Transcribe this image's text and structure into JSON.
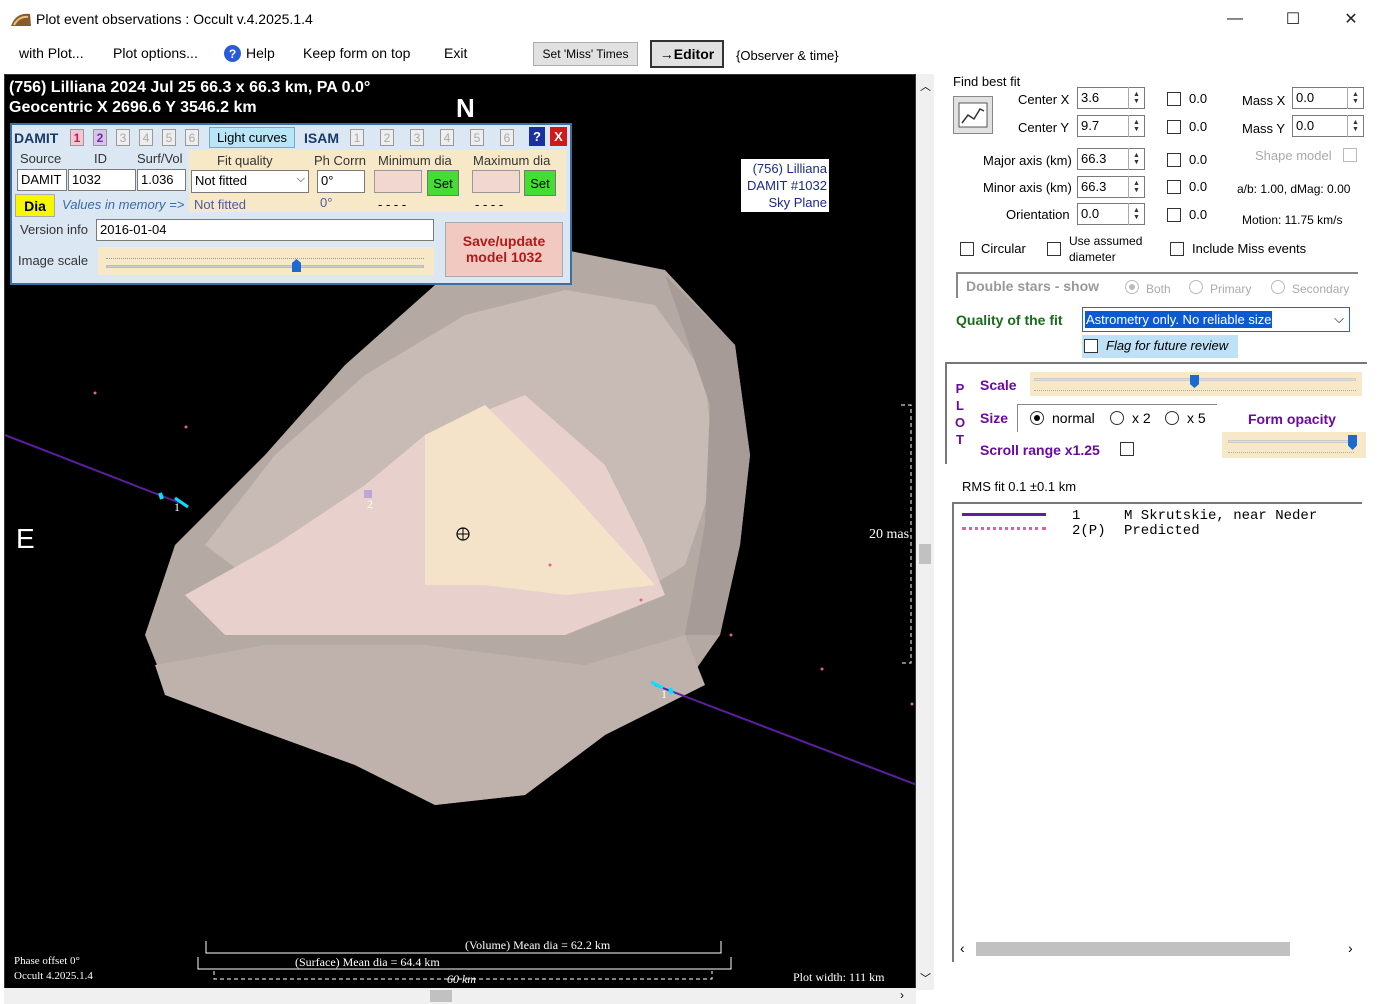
{
  "window": {
    "title": "Plot event observations : Occult v.4.2025.1.4",
    "minimize": "—",
    "maximize": "☐",
    "close": "✕"
  },
  "menu": {
    "with_plot": "with Plot...",
    "plot_options": "Plot options...",
    "help": "Help",
    "keep_on_top": "Keep form on top",
    "exit": "Exit",
    "set_miss_times": "Set 'Miss' Times",
    "editor": "→Editor",
    "observer_time": "{Observer & time}"
  },
  "plot": {
    "header_line1": "(756) Lilliana  2024 Jul 25   66.3 x 66.3 km, PA 0.0°",
    "header_line2": "Geocentric  X  2696.6  Y 3546.2 km",
    "north": "N",
    "east": "E",
    "model_label": [
      "(756) Lilliana",
      "DAMIT #1032",
      "Sky Plane"
    ],
    "scale_mas": "20 mas",
    "volume_dia": "(Volume) Mean dia = 62.2 km",
    "surface_dia": "(Surface) Mean dia = 64.4 km",
    "scale_km": "60 km",
    "phase_offset": "Phase offset 0°",
    "version": "Occult 4.2025.1.4",
    "plot_width": "Plot width: 111 km",
    "chord_labels": [
      "1",
      "2",
      "1"
    ]
  },
  "damit": {
    "damit_label": "DAMIT",
    "tabs": [
      "1",
      "2",
      "3",
      "4",
      "5",
      "6"
    ],
    "light_curves": "Light curves",
    "isam_label": "ISAM",
    "isam_tabs": [
      "1",
      "2",
      "3",
      "4",
      "5",
      "6"
    ],
    "help": "?",
    "close": "X",
    "source_label": "Source",
    "id_label": "ID",
    "surfvol_label": "Surf/Vol",
    "source": "DAMIT",
    "id": "1032",
    "surfvol": "1.036",
    "fit_quality_label": "Fit quality",
    "ph_corrn_label": "Ph Corrn",
    "min_dia_label": "Minimum dia",
    "max_dia_label": "Maximum dia",
    "fit_quality": "Not fitted",
    "ph_corrn": "0°",
    "set": "Set",
    "dia": "Dia",
    "values_in_memory": "Values in memory =>",
    "mem_fit": "Not fitted",
    "mem_ph": "0°",
    "mem_min": "- - - -",
    "mem_max": "- - - -",
    "version_label": "Version info",
    "version": "2016-01-04",
    "image_scale_label": "Image scale",
    "save_update": "Save/update",
    "model_num": "model 1032"
  },
  "fit": {
    "find_best_fit": "Find best fit",
    "center_x_label": "Center X",
    "center_x": "3.6",
    "center_y_label": "Center Y",
    "center_y": "9.7",
    "major_label": "Major axis (km)",
    "major": "66.3",
    "minor_label": "Minor axis (km)",
    "minor": "66.3",
    "orient_label": "Orientation",
    "orient": "0.0",
    "zero": "0.0",
    "mass_x_label": "Mass X",
    "mass_x": "0.0",
    "mass_y_label": "Mass Y",
    "mass_y": "0.0",
    "shape_model": "Shape model",
    "ab_dmag": "a/b: 1.00, dMag: 0.00",
    "motion": "Motion: 11.75 km/s",
    "circular": "Circular",
    "use_assumed": "Use assumed",
    "diameter": "diameter",
    "include_miss": "Include Miss events",
    "double_stars": "Double stars - show",
    "both": "Both",
    "primary": "Primary",
    "secondary": "Secondary",
    "quality_label": "Quality of the fit",
    "quality_value": "Astrometry only. No reliable size",
    "flag_review": "Flag for future review"
  },
  "plotbox": {
    "p": "P",
    "l": "L",
    "o": "O",
    "t": "T",
    "scale": "Scale",
    "size": "Size",
    "normal": "normal",
    "x2": "x 2",
    "x5": "x 5",
    "form_opacity": "Form opacity",
    "scroll_range": "Scroll range x1.25"
  },
  "rms": "RMS fit 0.1 ±0.1 km",
  "legend": [
    {
      "num": "1",
      "name": "M Skrutskie, near Neder"
    },
    {
      "num": "2(P)",
      "name": "Predicted"
    }
  ],
  "colors": {
    "chord": "#5b1fa0",
    "predicted": "#e0609c",
    "accent_green": "#1a6b1a"
  }
}
